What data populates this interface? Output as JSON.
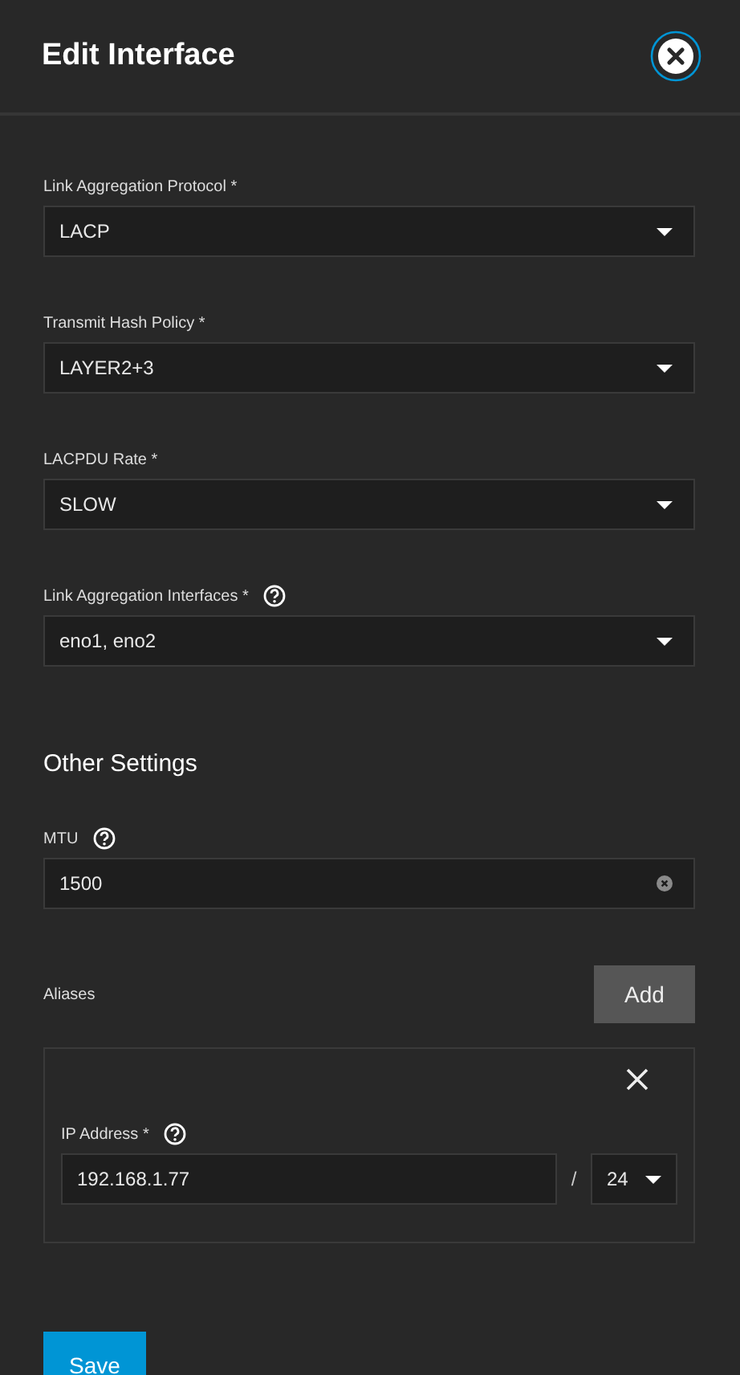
{
  "header": {
    "title": "Edit Interface"
  },
  "link_aggregation_fields": [
    {
      "kind": "select",
      "label": "Link Aggregation Protocol *",
      "value": "LACP",
      "help": false
    },
    {
      "kind": "select",
      "label": "Transmit Hash Policy *",
      "value": "LAYER2+3",
      "help": false
    },
    {
      "kind": "select",
      "label": "LACPDU Rate *",
      "value": "SLOW",
      "help": false
    },
    {
      "kind": "select",
      "label": "Link Aggregation Interfaces *",
      "value": "eno1, eno2",
      "help": true
    }
  ],
  "other_settings": {
    "heading": "Other Settings",
    "fields": [
      {
        "kind": "input",
        "label": "MTU",
        "value": "1500",
        "help": true
      }
    ]
  },
  "aliases": {
    "label": "Aliases",
    "add_button": "Add",
    "items": [
      {
        "ip_label": "IP Address *",
        "help": true,
        "ip": "192.168.1.77",
        "separator": "/",
        "netmask": "24"
      }
    ]
  },
  "save_button": "Save"
}
